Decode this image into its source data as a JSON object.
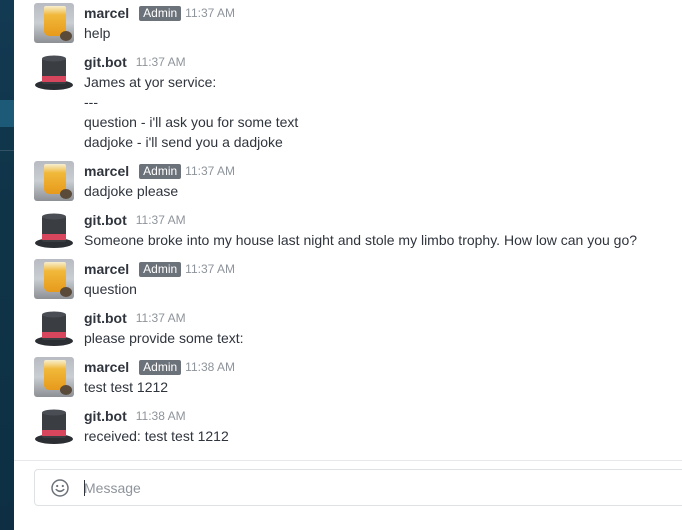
{
  "messages": [
    {
      "author": "marcel",
      "role": "Admin",
      "time": "11:37 AM",
      "lines": [
        "help"
      ]
    },
    {
      "author": "git.bot",
      "time": "11:37 AM",
      "lines": [
        "James at yor service:",
        "---",
        "question - i'll ask you for some text",
        "dadjoke - i'll send you a dadjoke"
      ]
    },
    {
      "author": "marcel",
      "role": "Admin",
      "time": "11:37 AM",
      "lines": [
        "dadjoke please"
      ]
    },
    {
      "author": "git.bot",
      "time": "11:37 AM",
      "lines": [
        "Someone broke into my house last night and stole my limbo trophy. How low can you go?"
      ]
    },
    {
      "author": "marcel",
      "role": "Admin",
      "time": "11:37 AM",
      "lines": [
        "question"
      ]
    },
    {
      "author": "git.bot",
      "time": "11:37 AM",
      "lines": [
        "please provide some text:"
      ]
    },
    {
      "author": "marcel",
      "role": "Admin",
      "time": "11:38 AM",
      "lines": [
        "test test 1212"
      ]
    },
    {
      "author": "git.bot",
      "time": "11:38 AM",
      "lines": [
        "received: test test 1212"
      ]
    }
  ],
  "composer": {
    "placeholder": "Message",
    "emoji_icon": "smiley-emoji-icon"
  },
  "colors": {
    "sidebar": "#0f3448",
    "role_badge": "#6c727a",
    "bot_hat_band": "#d8465e"
  }
}
